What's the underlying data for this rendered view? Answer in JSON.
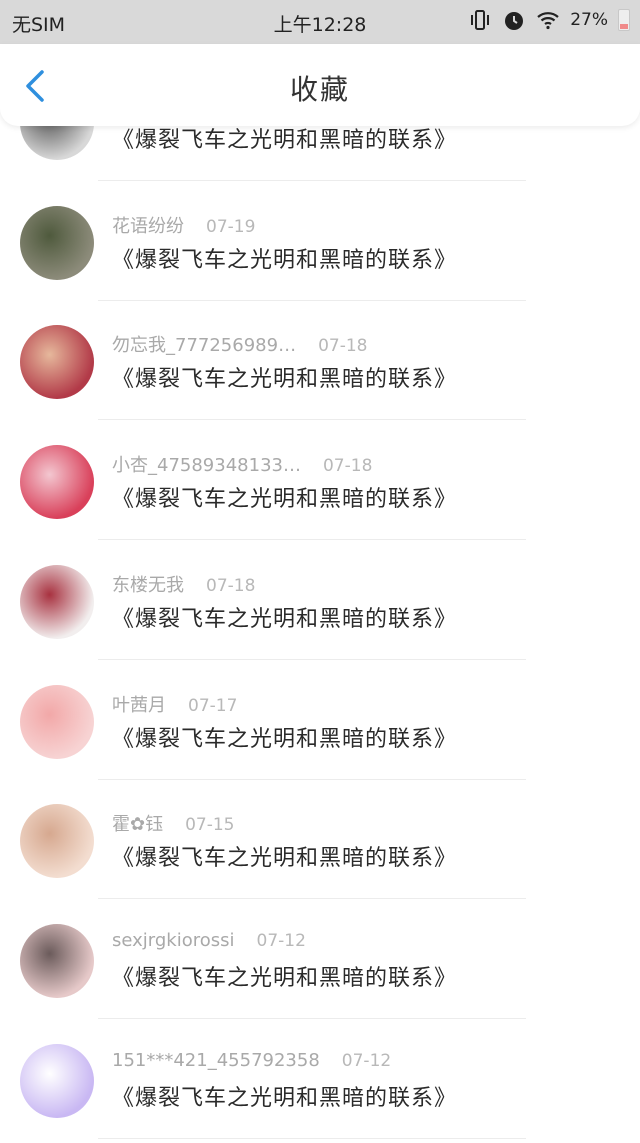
{
  "status_bar": {
    "carrier": "无SIM",
    "time": "上午12:28",
    "battery": "27%"
  },
  "header": {
    "title": "收藏"
  },
  "colors": {
    "accent": "#2f8fde",
    "text": "#2a2a2a",
    "meta": "#a9a9a9",
    "divider": "#ececec"
  },
  "items": [
    {
      "user": "",
      "date": "",
      "text": "《爆裂飞车之光明和黑暗的联系》",
      "avatar_colors": [
        "#d8d8d8",
        "#555555"
      ]
    },
    {
      "user": "花语纷纷",
      "date": "07-19",
      "text": "《爆裂飞车之光明和黑暗的联系》",
      "avatar_colors": [
        "#8c8b7a",
        "#4f5a3d"
      ]
    },
    {
      "user": "勿忘我_777256989…",
      "date": "07-18",
      "text": "《爆裂飞车之光明和黑暗的联系》",
      "avatar_colors": [
        "#b23a48",
        "#e6b89c"
      ]
    },
    {
      "user": "小杏_47589348133…",
      "date": "07-18",
      "text": "《爆裂飞车之光明和黑暗的联系》",
      "avatar_colors": [
        "#d9405a",
        "#f3c7d0"
      ]
    },
    {
      "user": "东楼无我",
      "date": "07-18",
      "text": "《爆裂飞车之光明和黑暗的联系》",
      "avatar_colors": [
        "#f2eeee",
        "#a83240"
      ]
    },
    {
      "user": "叶茜月",
      "date": "07-17",
      "text": "《爆裂飞车之光明和黑暗的联系》",
      "avatar_colors": [
        "#f7d3d3",
        "#f2a8a8"
      ]
    },
    {
      "user": "霍✿钰",
      "date": "07-15",
      "text": "《爆裂飞车之光明和黑暗的联系》",
      "avatar_colors": [
        "#f3ddd0",
        "#d6a88f"
      ]
    },
    {
      "user": "sexjrgkiorossi",
      "date": "07-12",
      "text": "《爆裂飞车之光明和黑暗的联系》",
      "avatar_colors": [
        "#e6c9c9",
        "#6b5b5b"
      ]
    },
    {
      "user": "151***421_455792358",
      "date": "07-12",
      "text": "《爆裂飞车之光明和黑暗的联系》",
      "avatar_colors": [
        "#c9b8f3",
        "#ffffff"
      ]
    }
  ]
}
